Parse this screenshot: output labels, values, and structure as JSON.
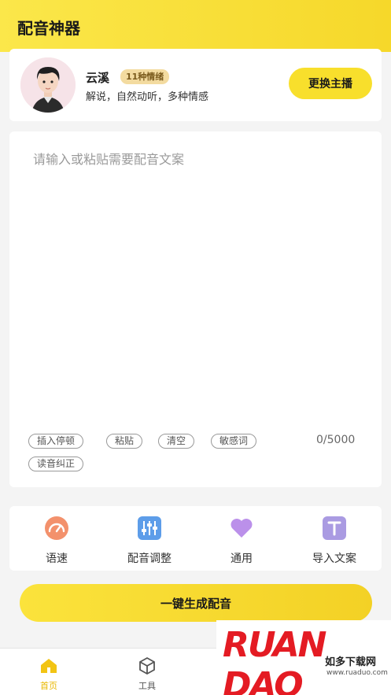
{
  "header": {
    "title": "配音神器"
  },
  "host": {
    "name": "云溪",
    "badge": "11种情绪",
    "description": "解说，自然动听，多种情感",
    "change_label": "更换主播"
  },
  "editor": {
    "placeholder": "请输入或粘贴需要配音文案",
    "value": "",
    "counter": "0/5000",
    "chips": [
      "插入停顿",
      "粘贴",
      "清空",
      "敏感词",
      "读音纠正"
    ]
  },
  "tools": [
    {
      "label": "语速",
      "icon": "speedometer-icon",
      "color": "#f0906a"
    },
    {
      "label": "配音调整",
      "icon": "sliders-icon",
      "color": "#5b9be8"
    },
    {
      "label": "通用",
      "icon": "heart-icon",
      "color": "#b98ee8"
    },
    {
      "label": "导入文案",
      "icon": "text-t-icon",
      "color": "#a99ae0"
    }
  ],
  "generate_label": "一键生成配音",
  "tabbar": {
    "items": [
      {
        "label": "首页",
        "icon": "home-icon",
        "active": true
      },
      {
        "label": "工具",
        "icon": "box-icon",
        "active": false
      }
    ]
  },
  "colors": {
    "accent": "#f8df2c",
    "active_tab": "#e9b800",
    "inactive_tab": "#555555"
  },
  "watermark": {
    "logo": "RUAN DAO",
    "sub": "如多下载网",
    "url": "www.ruaduo.com"
  }
}
